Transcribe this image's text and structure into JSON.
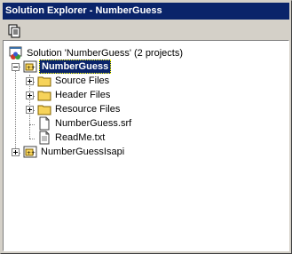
{
  "window": {
    "title": "Solution Explorer - NumberGuess"
  },
  "toolbar": {
    "properties_icon": "properties-pages-icon"
  },
  "tree": {
    "solution": {
      "label": "Solution 'NumberGuess' (2 projects)",
      "icon": "solution-icon"
    },
    "project_main": {
      "label": "NumberGuess",
      "icon": "vc-project-icon",
      "expanded": true,
      "children": [
        {
          "label": "Source Files",
          "icon": "folder-icon",
          "expandable": true
        },
        {
          "label": "Header Files",
          "icon": "folder-icon",
          "expandable": true
        },
        {
          "label": "Resource Files",
          "icon": "folder-icon",
          "expandable": true
        },
        {
          "label": "NumberGuess.srf",
          "icon": "file-icon",
          "expandable": false
        },
        {
          "label": "ReadMe.txt",
          "icon": "file-icon",
          "expandable": false
        }
      ]
    },
    "project_isapi": {
      "label": "NumberGuessIsapi",
      "icon": "vc-project-icon",
      "expanded": false
    }
  },
  "colors": {
    "title_bg": "#0a246a",
    "selection_bg": "#0a246a",
    "folder": "#f6d35a"
  }
}
